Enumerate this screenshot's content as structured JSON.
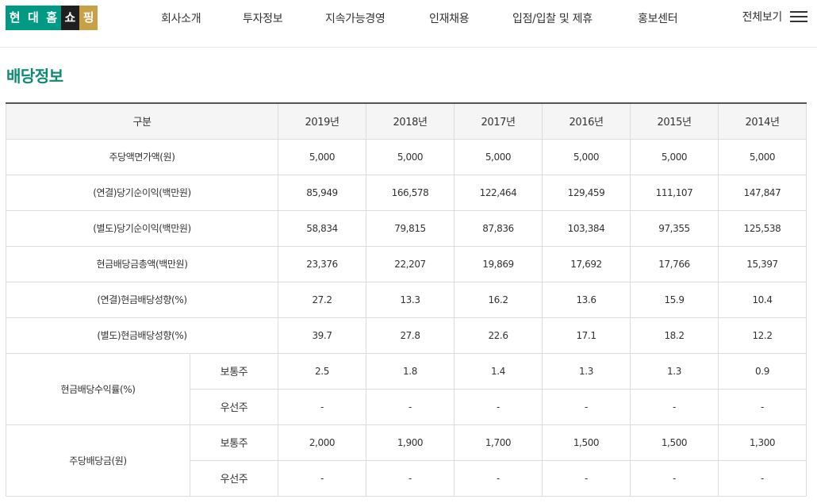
{
  "logo": {
    "chars": [
      "현",
      "대",
      "홈",
      "쇼",
      "핑"
    ],
    "colors": [
      "#009a84",
      "#009a84",
      "#009a84",
      "#1f1f1f",
      "#c8a046"
    ]
  },
  "nav": {
    "items": [
      "회사소개",
      "투자정보",
      "지속가능경영",
      "인재채용",
      "입점/입찰 및 제휴",
      "홍보센터"
    ],
    "all_label": "전체보기"
  },
  "page": {
    "title": "배당정보"
  },
  "table": {
    "header": [
      "구분",
      "2019년",
      "2018년",
      "2017년",
      "2016년",
      "2015년",
      "2014년"
    ],
    "rows": [
      {
        "label": "주당액면가액(원)",
        "values": [
          "5,000",
          "5,000",
          "5,000",
          "5,000",
          "5,000",
          "5,000"
        ]
      },
      {
        "label": "(연결)당기순이익(백만원)",
        "values": [
          "85,949",
          "166,578",
          "122,464",
          "129,459",
          "111,107",
          "147,847"
        ]
      },
      {
        "label": "(별도)당기순이익(백만원)",
        "values": [
          "58,834",
          "79,815",
          "87,836",
          "103,384",
          "97,355",
          "125,538"
        ]
      },
      {
        "label": "현금배당금총액(백만원)",
        "values": [
          "23,376",
          "22,207",
          "19,869",
          "17,692",
          "17,766",
          "15,397"
        ]
      },
      {
        "label": "(연결)현금배당성향(%)",
        "values": [
          "27.2",
          "13.3",
          "16.2",
          "13.6",
          "15.9",
          "10.4"
        ]
      },
      {
        "label": "(별도)현금배당성향(%)",
        "values": [
          "39.7",
          "27.8",
          "22.6",
          "17.1",
          "18.2",
          "12.2"
        ]
      }
    ],
    "groups": [
      {
        "label": "현금배당수익률(%)",
        "subs": [
          {
            "label": "보통주",
            "values": [
              "2.5",
              "1.8",
              "1.4",
              "1.3",
              "1.3",
              "0.9"
            ]
          },
          {
            "label": "우선주",
            "values": [
              "-",
              "-",
              "-",
              "-",
              "-",
              "-"
            ]
          }
        ]
      },
      {
        "label": "주당배당금(원)",
        "subs": [
          {
            "label": "보통주",
            "values": [
              "2,000",
              "1,900",
              "1,700",
              "1,500",
              "1,500",
              "1,300"
            ]
          },
          {
            "label": "우선주",
            "values": [
              "-",
              "-",
              "-",
              "-",
              "-",
              "-"
            ]
          }
        ]
      }
    ]
  }
}
